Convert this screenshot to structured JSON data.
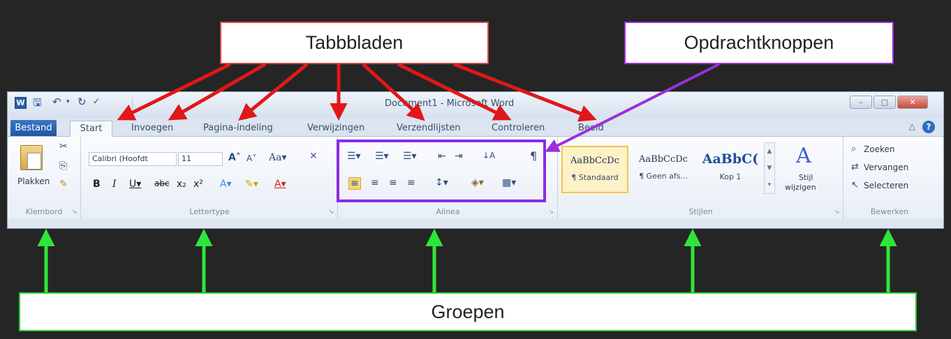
{
  "annotations": {
    "tabs_label": "Tabbbladen",
    "commands_label": "Opdrachtknoppen",
    "groups_label": "Groepen"
  },
  "window": {
    "title": "Document1 - Microsoft Word",
    "app_icon_letter": "W"
  },
  "tabs": [
    "Bestand",
    "Start",
    "Invoegen",
    "Pagina-indeling",
    "Verwijzingen",
    "Verzendlijsten",
    "Controleren",
    "Beeld"
  ],
  "ribbon": {
    "klembord": {
      "label": "Klembord",
      "paste": "Plakken"
    },
    "lettertype": {
      "label": "Lettertype",
      "font": "Calibri (Hoofdt",
      "size": "11"
    },
    "alinea": {
      "label": "Alinea"
    },
    "stijlen": {
      "label": "Stijlen",
      "styles": [
        {
          "sample": "AaBbCcDc",
          "name": "¶ Standaard"
        },
        {
          "sample": "AaBbCcDc",
          "name": "¶ Geen afs..."
        },
        {
          "sample": "AaBbC(",
          "name": "Kop 1"
        }
      ],
      "change_styles_line1": "Stijl",
      "change_styles_line2": "wijzigen"
    },
    "bewerken": {
      "label": "Bewerken",
      "find": "Zoeken",
      "replace": "Vervangen",
      "select": "Selecteren"
    }
  },
  "colors": {
    "tabs_arrow": "#e01818",
    "commands_arrow": "#9b30d8",
    "groups_arrow": "#2ee63a"
  },
  "icons": [
    "word-icon",
    "save-icon",
    "undo-icon",
    "redo-icon",
    "spelling-icon",
    "cut-icon",
    "copy-icon",
    "format-painter-icon",
    "help-icon",
    "find-icon",
    "replace-icon",
    "select-icon"
  ]
}
